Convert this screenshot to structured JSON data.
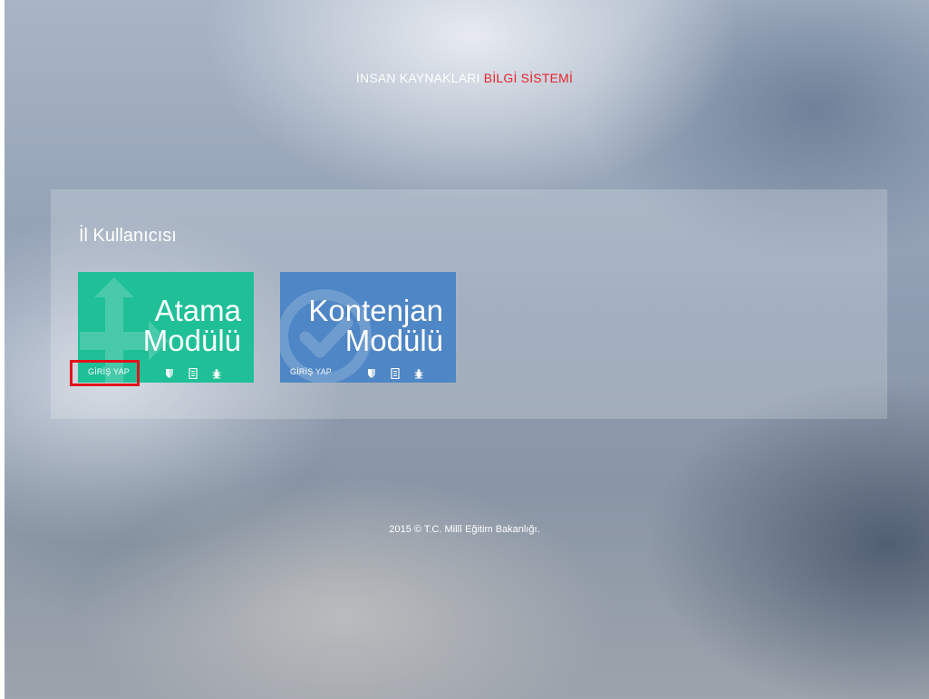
{
  "header": {
    "title_part1": "İNSAN KAYNAKLARI",
    "title_part2": "BİLGİ SİSTEMİ"
  },
  "panel": {
    "title": "İl Kullanıcısı",
    "tiles": [
      {
        "line1": "Atama",
        "line2": "Modülü",
        "login_label": "GİRİŞ YAP",
        "color": "#1fbf97",
        "background_icon": "arrows-icon",
        "footer_icons": [
          "shield-icon",
          "document-icon",
          "bug-icon"
        ]
      },
      {
        "line1": "Kontenjan",
        "line2": "Modülü",
        "login_label": "GİRİŞ YAP",
        "color": "#4f86c5",
        "background_icon": "check-circle-icon",
        "footer_icons": [
          "shield-icon",
          "document-icon",
          "bug-icon"
        ]
      }
    ]
  },
  "footer": {
    "copyright": "2015 © T.C. Millî Eğitim Bakanlığı."
  },
  "colors": {
    "accent_red": "#e8262f",
    "highlight_red": "#e1141c"
  }
}
